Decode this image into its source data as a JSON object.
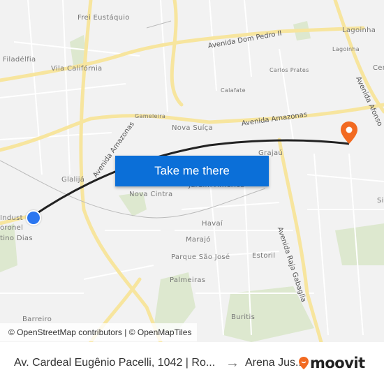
{
  "map": {
    "labels": {
      "frei_eustaquio": "Frei Eustáquio",
      "lagoinha": "Lagoinha",
      "lagoinha_small": "Lagoinha",
      "filadelfia": "Filadélfia",
      "vila_california": "Vila Califórnia",
      "carlos_prates": "Carlos Prates",
      "calafate": "Calafate",
      "gameleira": "Gameleira",
      "nova_suica": "Nova Suíça",
      "glalija": "Glalijá",
      "grajau": "Grajaú",
      "jardim_america": "Jardim América",
      "nova_cintra": "Nova Cintra",
      "indust": "Indust",
      "coronel": "oronel",
      "tino_dias": "tino Dias",
      "havai": "Havaí",
      "marajo": "Marajó",
      "parque_sao_jose": "Parque São José",
      "estoril": "Estoril",
      "palmeiras": "Palmeiras",
      "buritis": "Buritis",
      "barreiro": "Barreiro",
      "cen": "Cen",
      "si": "Si"
    },
    "roads": {
      "dom_pedro": "Avenida Dom Pedro II",
      "amazonas_1": "Avenida Amazonas",
      "amazonas_2": "Avenida Amazonas",
      "afonso": "Avenida Afonso",
      "raja": "Avenida Raja Gabaglia"
    },
    "route_color": "#222222",
    "start_color": "#2b76f0",
    "destination_color": "#f26a21"
  },
  "cta": {
    "label": "Take me there"
  },
  "attribution": "© OpenStreetMap contributors | © OpenMapTiles",
  "footer": {
    "from": "Av. Cardeal Eugênio Pacelli, 1042 | Ro...",
    "arrow": "→",
    "to": "Arena Jus...",
    "brand": "moovit",
    "brand_color": "#f26a21"
  }
}
